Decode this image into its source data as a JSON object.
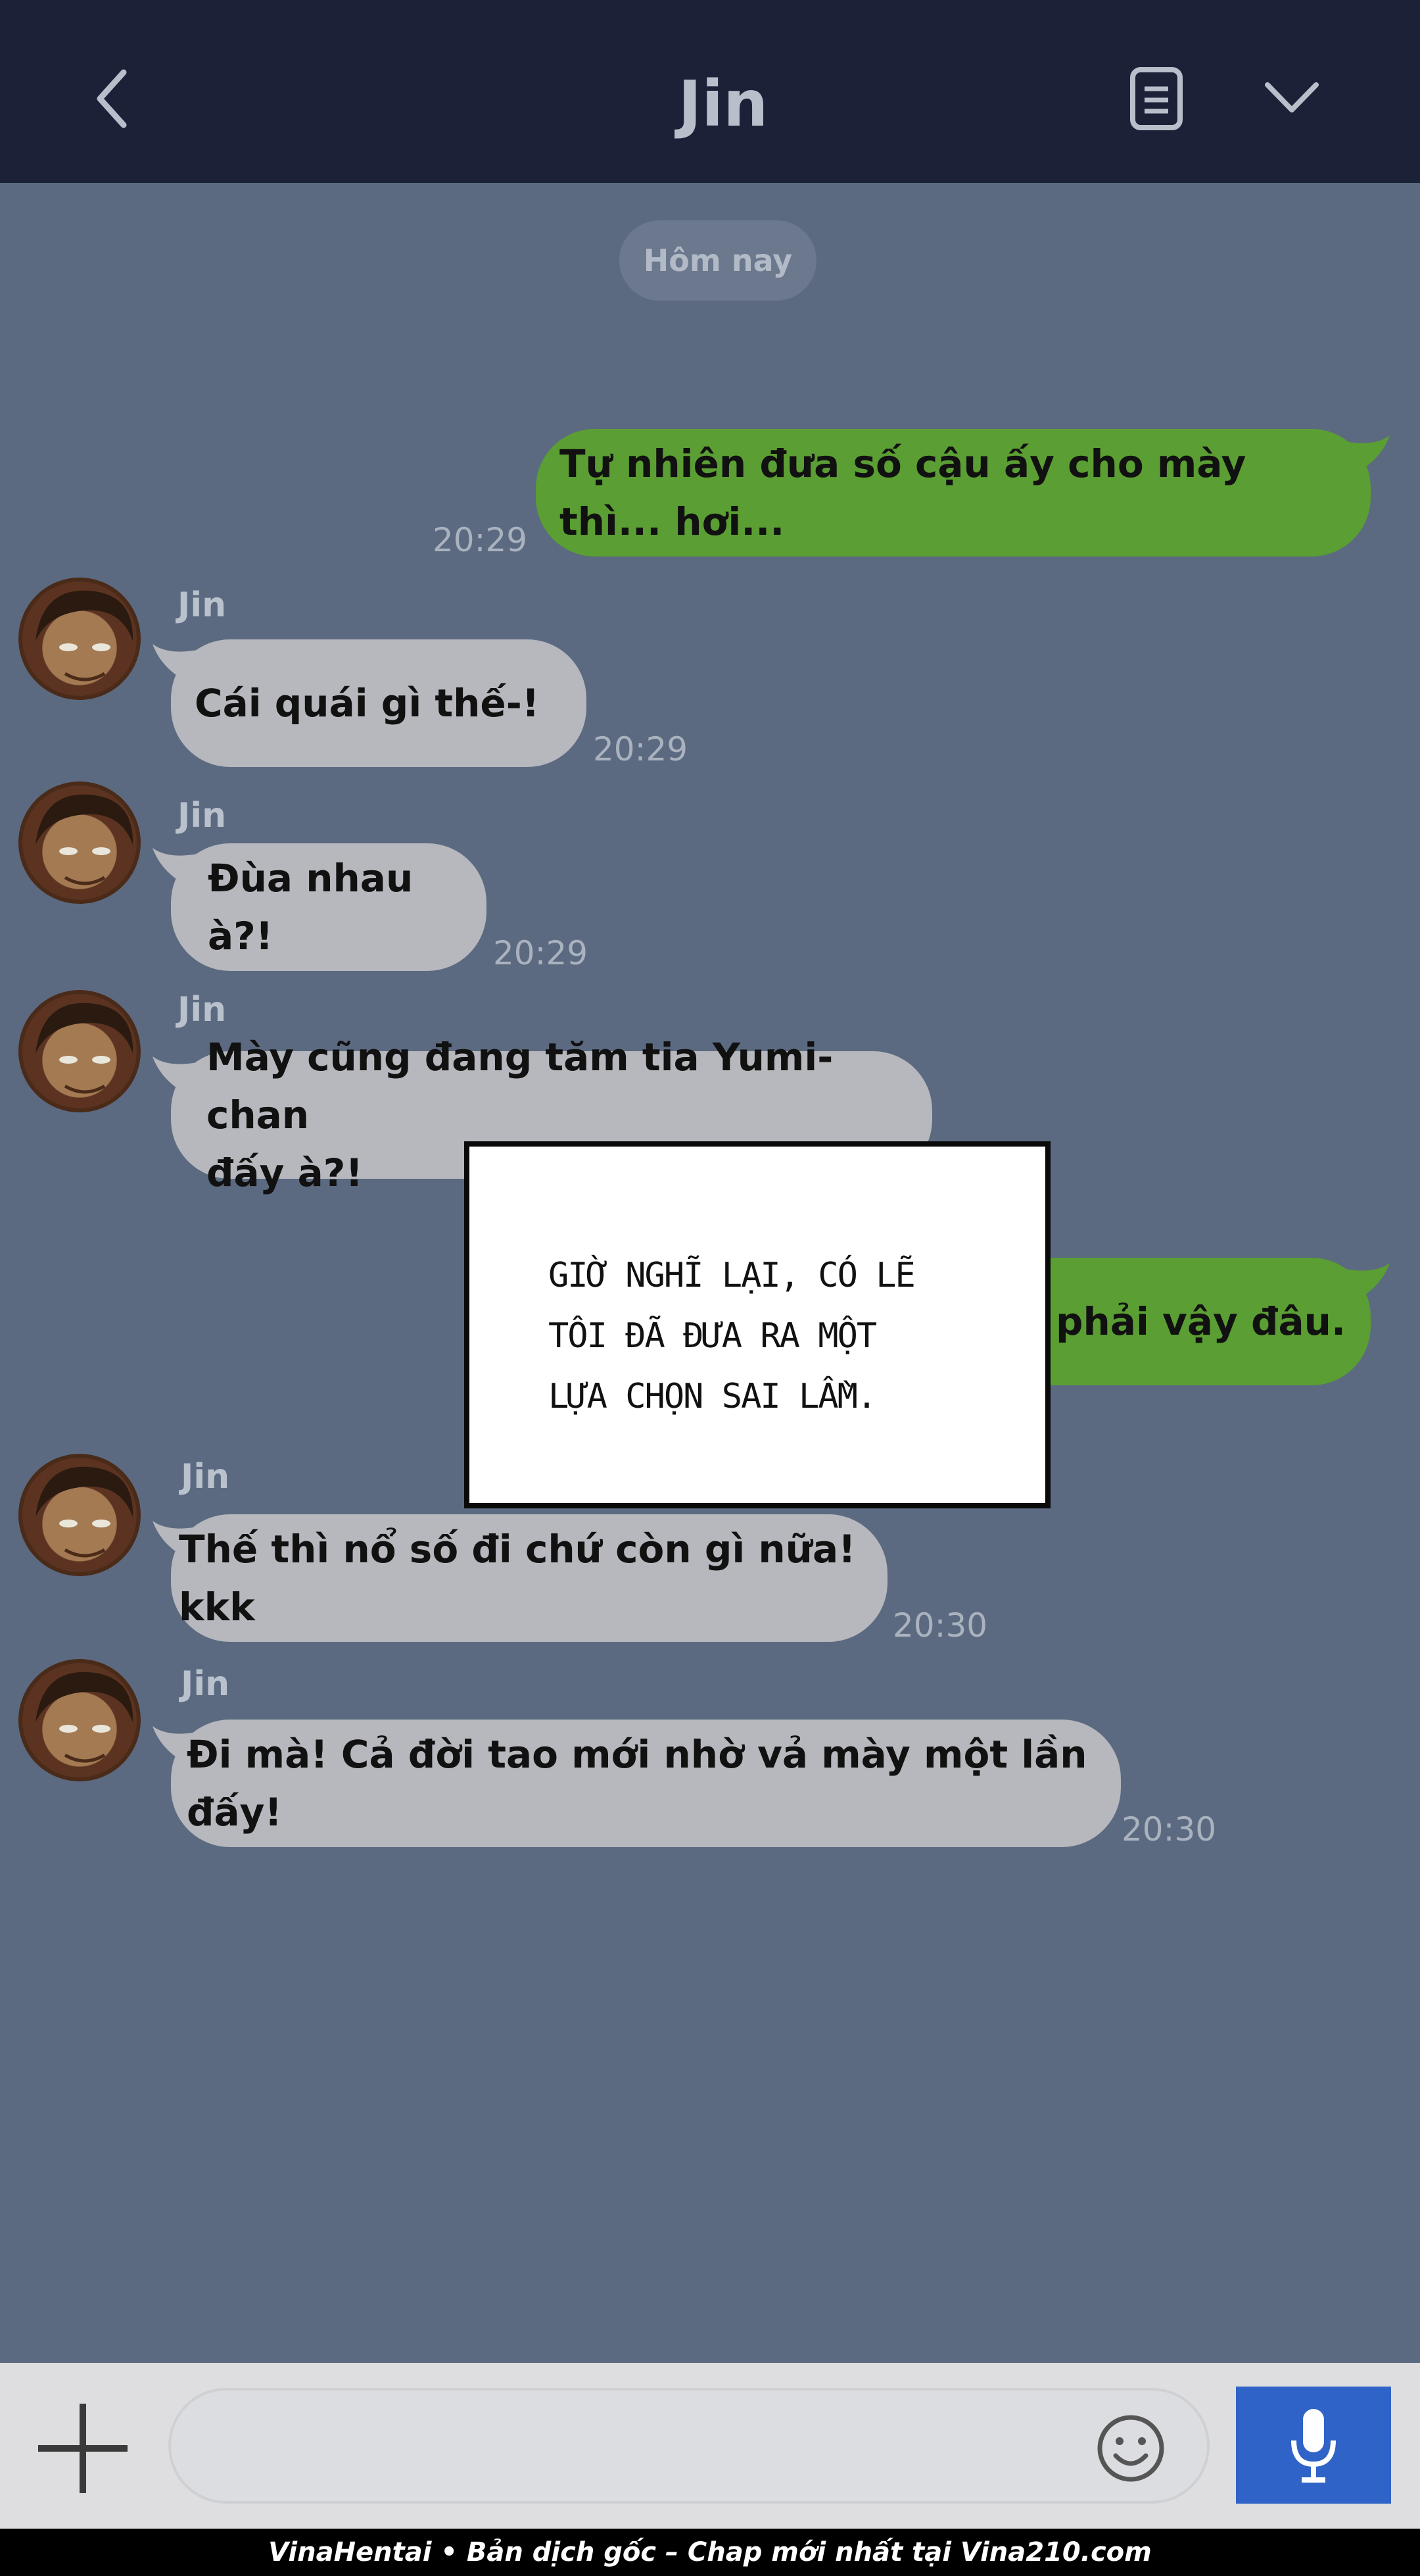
{
  "header": {
    "title": "Jin",
    "back_icon": "chevron-left-icon",
    "notes_icon": "notes-icon",
    "menu_icon": "chevron-down-icon"
  },
  "chat": {
    "date_label": "Hôm nay",
    "messages": [
      {
        "direction": "out",
        "text": "Tự nhiên đưa số cậu ấy cho mày thì... hơi...",
        "time": "20:29"
      },
      {
        "direction": "in",
        "sender": "Jin",
        "text": "Cái quái gì thế-!",
        "time": "20:29"
      },
      {
        "direction": "in",
        "sender": "Jin",
        "text": "Đùa nhau à?!",
        "time": "20:29"
      },
      {
        "direction": "in",
        "sender": "Jin",
        "text_line1": "Mày cũng đang tăm tia Yumi-chan",
        "text_line2": "đấy à?!"
      },
      {
        "direction": "out",
        "text": "g phải vậy đâu."
      },
      {
        "direction": "in",
        "sender": "Jin",
        "text": "Thế thì nổ số đi chứ còn gì nữa! kkk",
        "time": "20:30"
      },
      {
        "direction": "in",
        "sender": "Jin",
        "text": "Đi mà! Cả đời tao mới nhờ vả mày một lần đấy!",
        "time": "20:30"
      }
    ]
  },
  "caption_box": {
    "line1": "GIỜ NGHĨ LẠI, CÓ LẼ",
    "line2": "TÔI ĐÃ ĐƯA RA MỘT",
    "line3": "LỰA CHỌN SAI LẦM."
  },
  "input_bar": {
    "plus_icon": "plus-icon",
    "emoji_icon": "smiley-icon",
    "mic_icon": "microphone-icon",
    "input_value": ""
  },
  "footer": {
    "text": "VinaHentai • Bản dịch gốc – Chap mới nhất tại Vina210.com"
  },
  "colors": {
    "header_bg": "#1b2238",
    "chat_bg": "#5b6a80",
    "incoming_bubble": "#b6b8bd",
    "outgoing_bubble": "#5b9e33",
    "mic_button": "#2f63c7"
  }
}
